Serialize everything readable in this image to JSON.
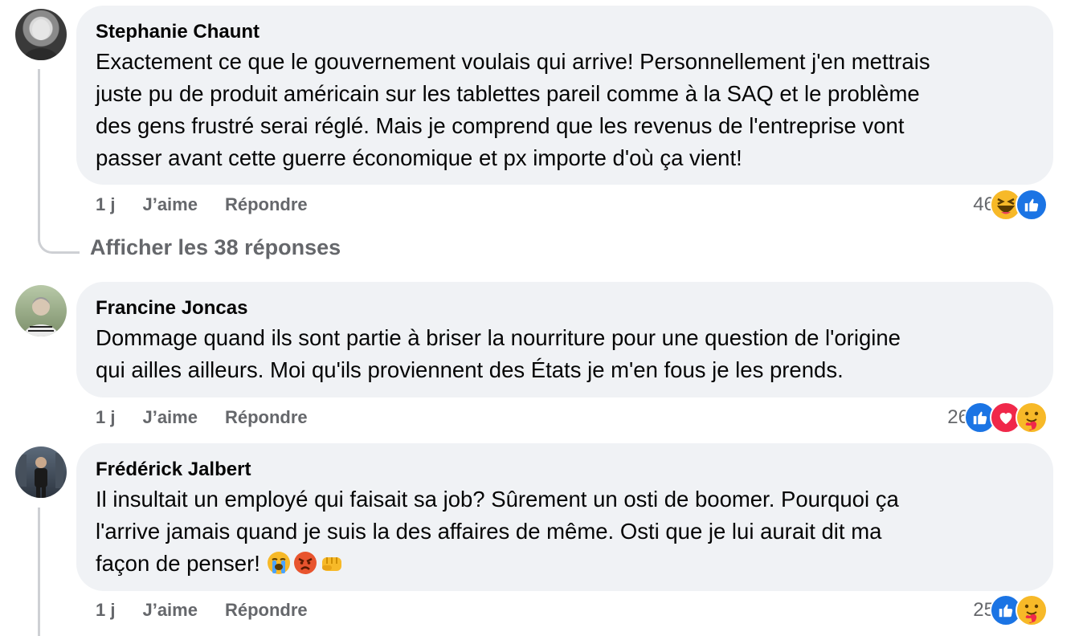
{
  "comments": [
    {
      "author": "Stephanie Chaunt",
      "text": "Exactement ce que le gouvernement voulais qui arrive! Personnellement j'en mettrais\njuste pu de produit américain sur les tablettes pareil comme à la SAQ et le problème\ndes gens frustré serai réglé. Mais je comprend que les revenus de l'entreprise vont\npasser avant cette guerre économique et px importe d'où ça vient!",
      "time": "1 j",
      "like_label": "J’aime",
      "reply_label": "Répondre",
      "reaction_count": "46",
      "reactions": [
        "haha-icon",
        "like-icon"
      ]
    },
    {
      "author": "Francine Joncas",
      "text": "Dommage quand ils sont partie à briser la nourriture pour une question de l'origine\nqui ailles ailleurs. Moi qu'ils proviennent des États je m'en fous je les prends.",
      "time": "1 j",
      "like_label": "J’aime",
      "reply_label": "Répondre",
      "reaction_count": "26",
      "reactions": [
        "like-icon",
        "love-icon",
        "care-icon"
      ]
    },
    {
      "author": "Frédérick Jalbert",
      "text": "Il insultait un employé qui faisait sa job? Sûrement un osti de boomer. Pourquoi ça\nl'arrive jamais quand je suis la des affaires de même. Osti que je lui aurait dit ma\nfaçon de penser!",
      "trailing_emojis": [
        "loudly-crying-face-emoji",
        "angry-face-emoji",
        "oncoming-fist-emoji"
      ],
      "time": "1 j",
      "like_label": "J’aime",
      "reply_label": "Répondre",
      "reaction_count": "25",
      "reactions": [
        "like-icon",
        "care-icon"
      ]
    }
  ],
  "view_replies_label": "Afficher les 38 réponses",
  "colors": {
    "bubble": "#f0f2f5",
    "secondary_text": "#65676b",
    "like_blue": "#1b74e4",
    "love_red": "#f0284a",
    "emoji_yellow": "#f7b928"
  }
}
